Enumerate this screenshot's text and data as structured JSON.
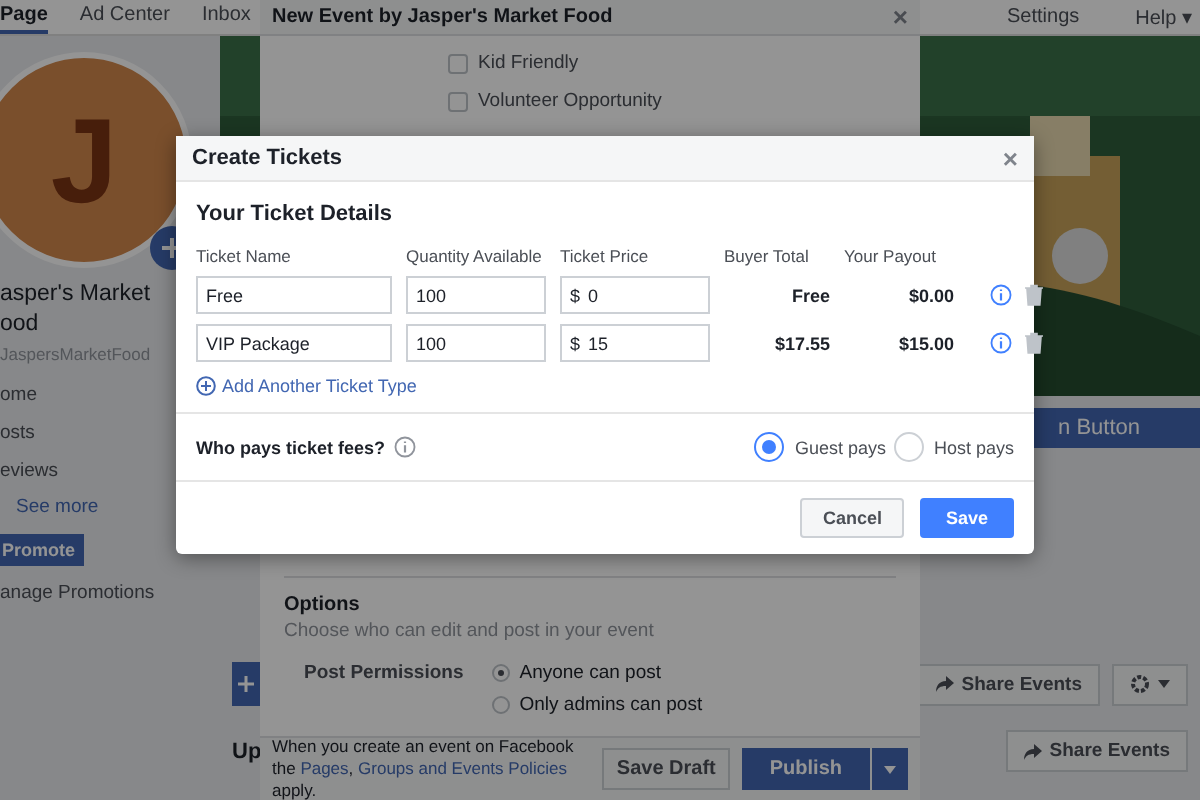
{
  "nav": {
    "tabs": [
      {
        "label": "Page",
        "selected": true
      },
      {
        "label": "Ad Center",
        "selected": false
      },
      {
        "label": "Inbox",
        "selected": false
      }
    ],
    "right": [
      {
        "label": "Settings"
      },
      {
        "label": "Help ▾"
      }
    ]
  },
  "sidebar": {
    "avatar_letter": "J",
    "name_lines": [
      "asper's Market",
      "ood"
    ],
    "handle": "JaspersMarketFood",
    "items": [
      "ome",
      "osts",
      "eviews"
    ],
    "see_more": "See more",
    "promote": "Promote",
    "manage": "anage Promotions"
  },
  "main": {
    "cta": "n Button",
    "share_events": [
      "Share Events",
      "Share Events"
    ],
    "heading": "Up"
  },
  "event_modal": {
    "title": "New Event by Jasper's Market Food",
    "checkboxes": [
      {
        "label": "Kid Friendly",
        "checked": false
      },
      {
        "label": "Volunteer Opportunity",
        "checked": false
      }
    ],
    "options_title": "Options",
    "options_hint": "Choose who can edit and post in your event",
    "permissions_label": "Post Permissions",
    "permissions": [
      {
        "label": "Anyone can post",
        "selected": true
      },
      {
        "label": "Only admins can post",
        "selected": false
      }
    ],
    "close": "×",
    "footer_parts": [
      "When you create an event on Facebook the ",
      "Pages",
      ", ",
      "Groups and Events Policies",
      " apply."
    ],
    "save_draft": "Save Draft",
    "publish": "Publish"
  },
  "tickets_modal": {
    "title": "Create Tickets",
    "close": "×",
    "section": "Your Ticket Details",
    "columns": [
      "Ticket Name",
      "Quantity Available",
      "Ticket Price",
      "Buyer Total",
      "Your Payout"
    ],
    "currency": "$",
    "tickets": [
      {
        "name": "Free",
        "quantity": "100",
        "price": "0",
        "buyer_total": "Free",
        "payout": "$0.00"
      },
      {
        "name": "VIP Package",
        "quantity": "100",
        "price": "15",
        "buyer_total": "$17.55",
        "payout": "$15.00"
      }
    ],
    "add_link": "Add Another Ticket Type",
    "fees_question": "Who pays ticket fees?",
    "payers": [
      {
        "label": "Guest pays",
        "selected": true
      },
      {
        "label": "Host pays",
        "selected": false
      }
    ],
    "cancel": "Cancel",
    "save": "Save"
  }
}
